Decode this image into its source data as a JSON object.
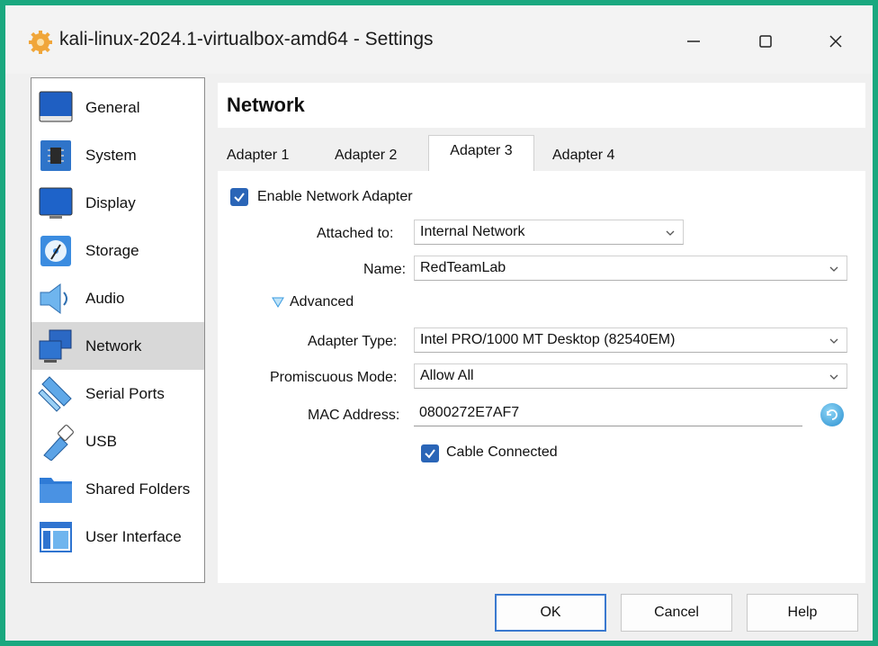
{
  "window": {
    "title": "kali-linux-2024.1-virtualbox-amd64 - Settings"
  },
  "sidebar": {
    "items": [
      {
        "label": "General",
        "icon": "general-icon"
      },
      {
        "label": "System",
        "icon": "system-chip-icon"
      },
      {
        "label": "Display",
        "icon": "display-monitor-icon"
      },
      {
        "label": "Storage",
        "icon": "storage-disk-icon"
      },
      {
        "label": "Audio",
        "icon": "speaker-icon"
      },
      {
        "label": "Network",
        "icon": "network-icon"
      },
      {
        "label": "Serial Ports",
        "icon": "serial-port-icon"
      },
      {
        "label": "USB",
        "icon": "usb-icon"
      },
      {
        "label": "Shared Folders",
        "icon": "folder-icon"
      },
      {
        "label": "User Interface",
        "icon": "user-interface-icon"
      }
    ],
    "selected": "Network"
  },
  "page": {
    "title": "Network"
  },
  "tabs": [
    {
      "label": "Adapter 1"
    },
    {
      "label": "Adapter 2"
    },
    {
      "label": "Adapter 3"
    },
    {
      "label": "Adapter 4"
    }
  ],
  "active_tab": "Adapter 3",
  "form": {
    "enable_label": "Enable Network Adapter",
    "enable_checked": true,
    "attached_label": "Attached to:",
    "attached_value": "Internal Network",
    "name_label": "Name:",
    "name_value": "RedTeamLab",
    "advanced_label": "Advanced",
    "adapter_type_label": "Adapter Type:",
    "adapter_type_value": "Intel PRO/1000 MT Desktop (82540EM)",
    "promiscuous_label": "Promiscuous Mode:",
    "promiscuous_value": "Allow All",
    "mac_label": "MAC Address:",
    "mac_value": "0800272E7AF7",
    "cable_label": "Cable Connected",
    "cable_checked": true
  },
  "buttons": {
    "ok": "OK",
    "cancel": "Cancel",
    "help": "Help"
  },
  "colors": {
    "accent": "#2a65b7",
    "frame": "#1aa87f",
    "selected_item": "#d8d8d8"
  }
}
